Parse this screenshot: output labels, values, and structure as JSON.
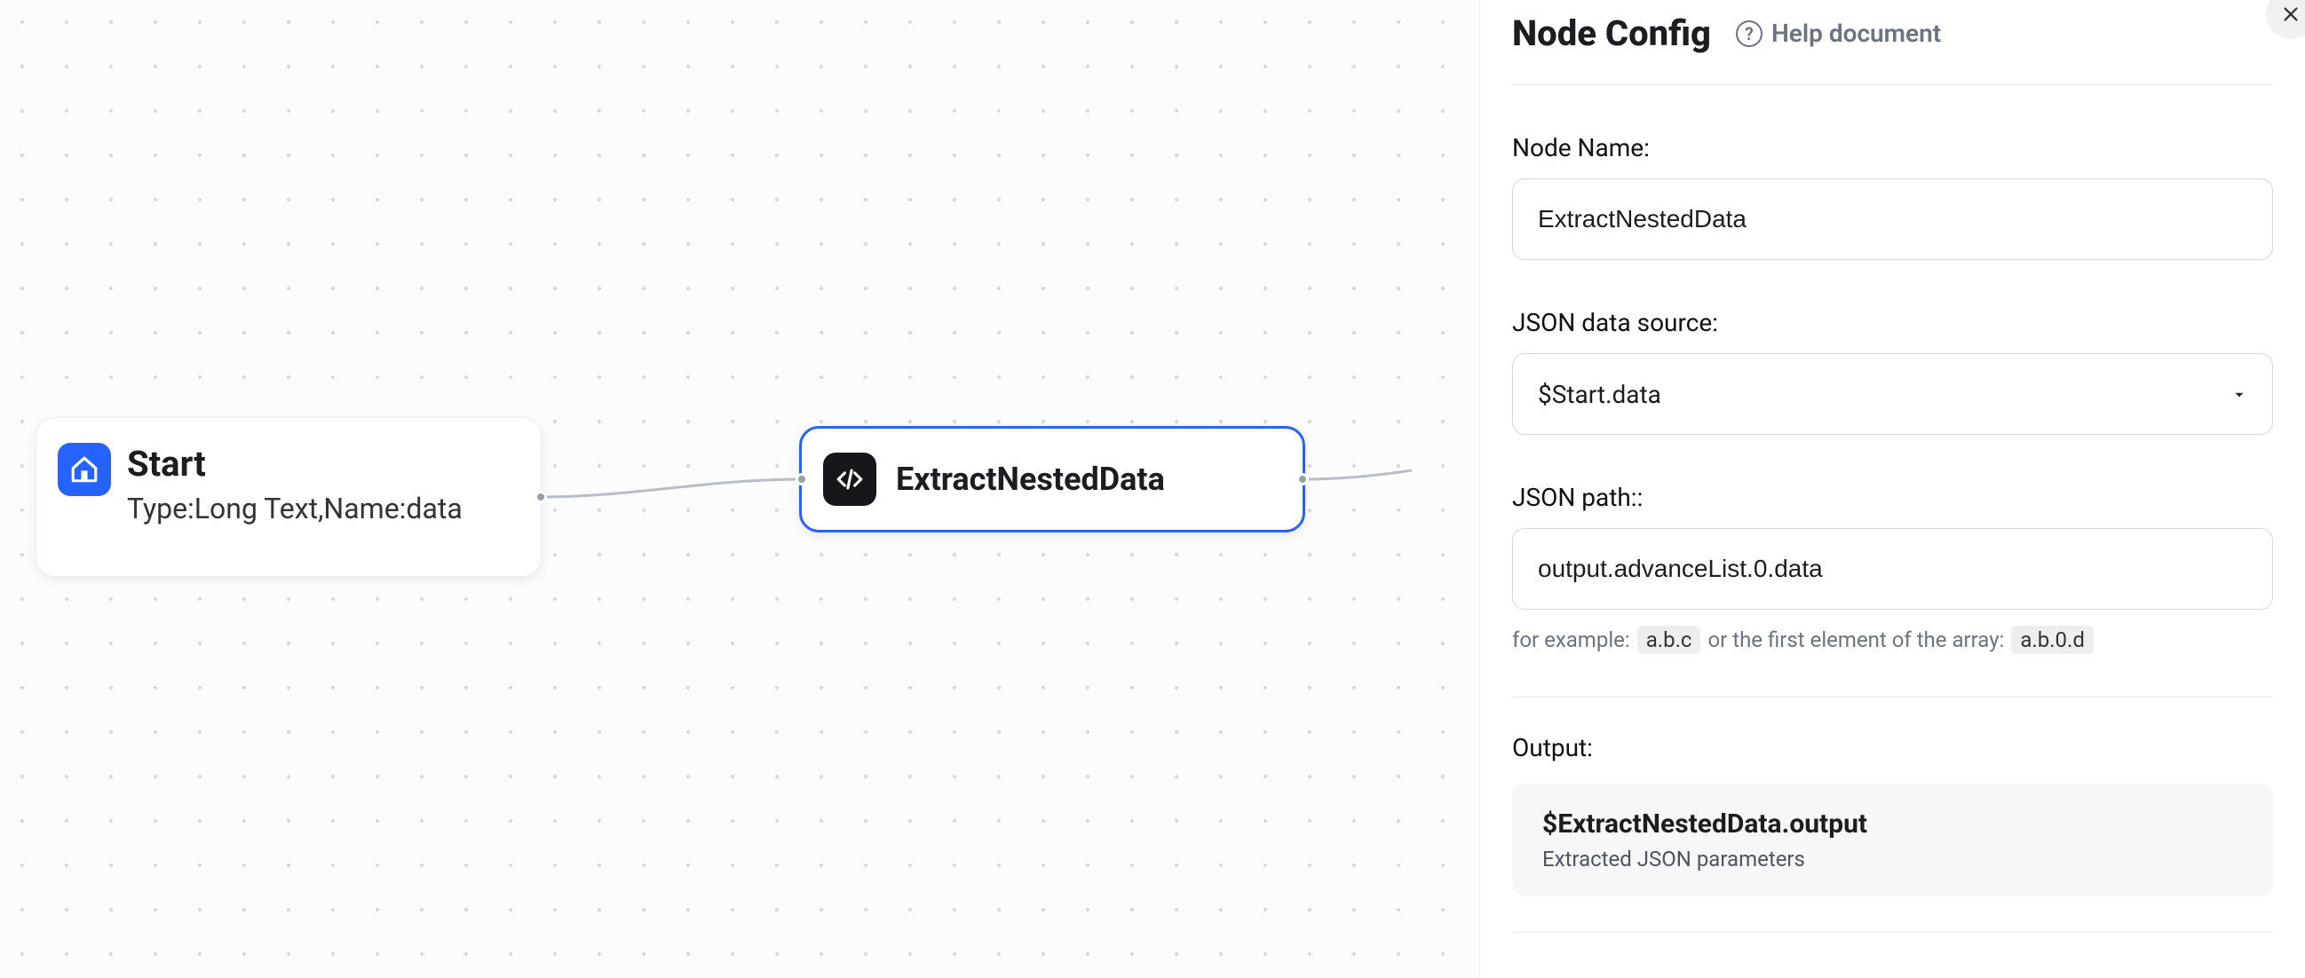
{
  "canvas": {
    "startNode": {
      "title": "Start",
      "subtitle": "Type:Long Text,Name:data"
    },
    "extractNode": {
      "title": "ExtractNestedData"
    }
  },
  "panel": {
    "title": "Node Config",
    "helpLabel": "Help document",
    "nodeName": {
      "label": "Node Name:",
      "value": "ExtractNestedData"
    },
    "dataSource": {
      "label": "JSON data source:",
      "value": "$Start.data"
    },
    "jsonPath": {
      "label": "JSON path::",
      "value": "output.advanceList.0.data",
      "hintPrefix": "for example:",
      "hintExample1": "a.b.c",
      "hintMiddle": "or the first element of the array:",
      "hintExample2": "a.b.0.d"
    },
    "output": {
      "label": "Output:",
      "variable": "$ExtractNestedData.output",
      "description": "Extracted JSON parameters"
    }
  }
}
